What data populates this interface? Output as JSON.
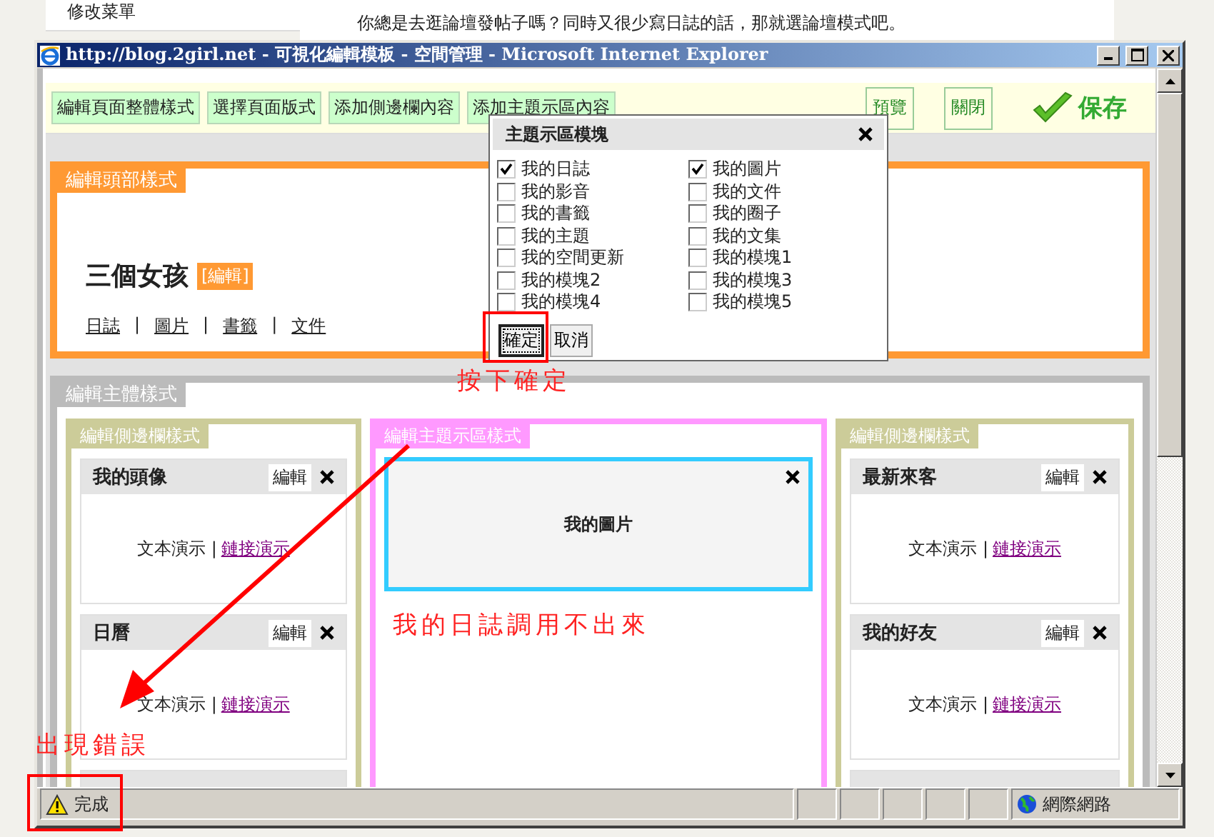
{
  "background_page": {
    "sidebar_item": "修改菜單",
    "description": "你總是去逛論壇發帖子嗎？同時又很少寫日誌的話，那就選論壇模式吧。"
  },
  "window": {
    "title": "http://blog.2girl.net - 可視化編輯模板 - 空間管理 - Microsoft Internet Explorer"
  },
  "toolbar": {
    "buttons": [
      "編輯頁面整體樣式",
      "選擇頁面版式",
      "添加側邊欄內容",
      "添加主題示區內容"
    ],
    "actions": [
      "預覽",
      "關閉"
    ],
    "save": "保存"
  },
  "header_panel": {
    "label": "編輯頭部樣式",
    "blog_title": "三個女孩",
    "edit_tag": "[編輯]",
    "nav": [
      "日誌",
      "圖片",
      "書籤",
      "文件"
    ],
    "nav_separators": [
      "|",
      "|",
      "|"
    ]
  },
  "body_panel": {
    "label": "編輯主體樣式",
    "left_sidebar": {
      "label": "編輯側邊欄樣式",
      "widgets": [
        {
          "title": "我的頭像",
          "edit": "編輯",
          "text": "文本演示 |",
          "link": "鏈接演示"
        },
        {
          "title": "日曆",
          "edit": "編輯",
          "text": "文本演示 |",
          "link": "鏈接演示"
        }
      ]
    },
    "main_area": {
      "label": "編輯主題示區樣式",
      "module": "我的圖片"
    },
    "right_sidebar": {
      "label": "編輯側邊欄樣式",
      "widgets": [
        {
          "title": "最新來客",
          "edit": "編輯",
          "text": "文本演示 |",
          "link": "鏈接演示"
        },
        {
          "title": "我的好友",
          "edit": "編輯",
          "text": "文本演示 |",
          "link": "鏈接演示"
        }
      ]
    }
  },
  "dialog": {
    "title": "主題示區模塊",
    "columns": [
      [
        {
          "label": "我的日誌",
          "checked": true
        },
        {
          "label": "我的影音",
          "checked": false
        },
        {
          "label": "我的書籤",
          "checked": false
        },
        {
          "label": "我的主題",
          "checked": false
        },
        {
          "label": "我的空間更新",
          "checked": false
        },
        {
          "label": "我的模塊2",
          "checked": false
        },
        {
          "label": "我的模塊4",
          "checked": false
        }
      ],
      [
        {
          "label": "我的圖片",
          "checked": true
        },
        {
          "label": "我的文件",
          "checked": false
        },
        {
          "label": "我的圈子",
          "checked": false
        },
        {
          "label": "我的文集",
          "checked": false
        },
        {
          "label": "我的模塊1",
          "checked": false
        },
        {
          "label": "我的模塊3",
          "checked": false
        },
        {
          "label": "我的模塊5",
          "checked": false
        }
      ]
    ],
    "ok": "確定",
    "cancel": "取消"
  },
  "status_bar": {
    "text": "完成",
    "zone": "網際網路"
  },
  "annotations": [
    "按下確定",
    "我的日誌調用不出來",
    "出現錯誤"
  ]
}
